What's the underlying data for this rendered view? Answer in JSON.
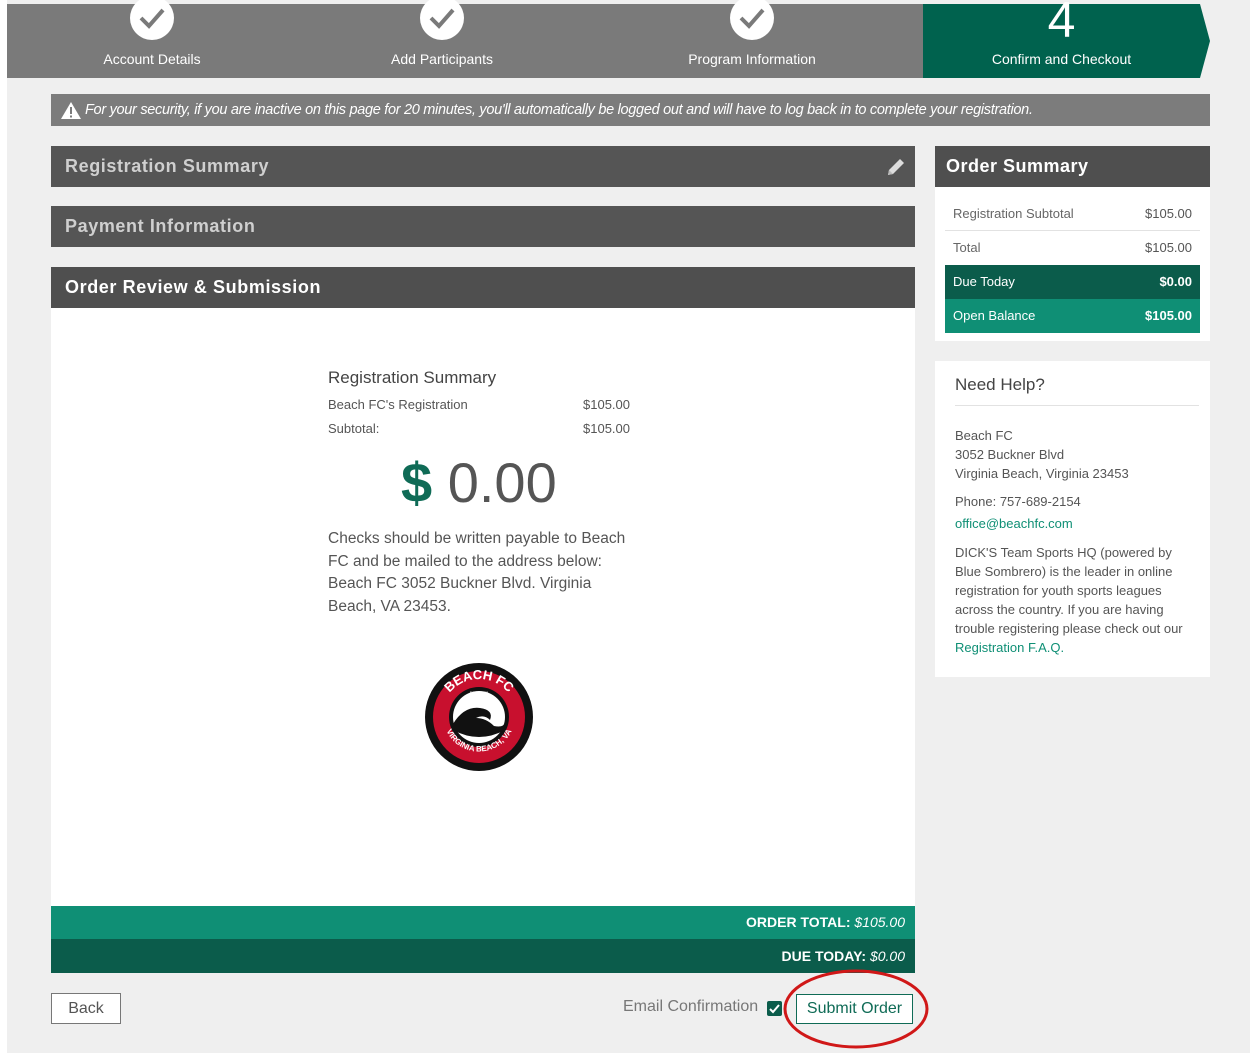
{
  "steps": [
    {
      "label": "Account Details"
    },
    {
      "label": "Add Participants"
    },
    {
      "label": "Program Information"
    },
    {
      "label": "Confirm and Checkout",
      "number": "4"
    }
  ],
  "warning": "For your security, if you are inactive on this page for 20 minutes, you'll automatically be logged out and will have to log back in to complete your registration.",
  "sections": {
    "registration_summary": "Registration Summary",
    "payment_information": "Payment Information",
    "order_review": "Order Review & Submission"
  },
  "review": {
    "title": "Registration Summary",
    "item_label": "Beach FC's Registration",
    "item_amount": "$105.00",
    "subtotal_label": "Subtotal:",
    "subtotal_amount": "$105.00",
    "big_dollar": "$",
    "big_amount": "0.00",
    "checks_text": "Checks should be written payable to Beach FC and be mailed to the address below: Beach FC 3052 Buckner Blvd. Virginia Beach, VA 23453.",
    "logo_top": "BEACH FC",
    "logo_est": "EST. 1989",
    "logo_bottom": "VIRGINIA BEACH, VA"
  },
  "totals": {
    "order_total_label": "ORDER TOTAL:",
    "order_total_value": "$105.00",
    "due_today_label": "DUE TODAY:",
    "due_today_value": "$0.00"
  },
  "actions": {
    "back": "Back",
    "email_confirmation": "Email Confirmation",
    "submit": "Submit Order"
  },
  "order_summary": {
    "title": "Order Summary",
    "rows": [
      {
        "label": "Registration Subtotal",
        "amount": "$105.00"
      },
      {
        "label": "Total",
        "amount": "$105.00"
      },
      {
        "label": "Due Today",
        "amount": "$0.00"
      },
      {
        "label": "Open Balance",
        "amount": "$105.00"
      }
    ]
  },
  "help": {
    "title": "Need Help?",
    "org": "Beach FC",
    "street": "3052 Buckner Blvd",
    "city": "Virginia Beach, Virginia 23453",
    "phone": "Phone: 757-689-2154",
    "email": "office@beachfc.com",
    "desc": "DICK'S Team Sports HQ (powered by Blue Sombrero) is the leader in online registration for youth sports leagues across the country. If you are having trouble registering please check out our ",
    "faq_link": "Registration F.A.Q."
  },
  "colors": {
    "brand_dark": "#0b5c4b",
    "brand": "#0f8f75",
    "annotation": "#d01818"
  }
}
